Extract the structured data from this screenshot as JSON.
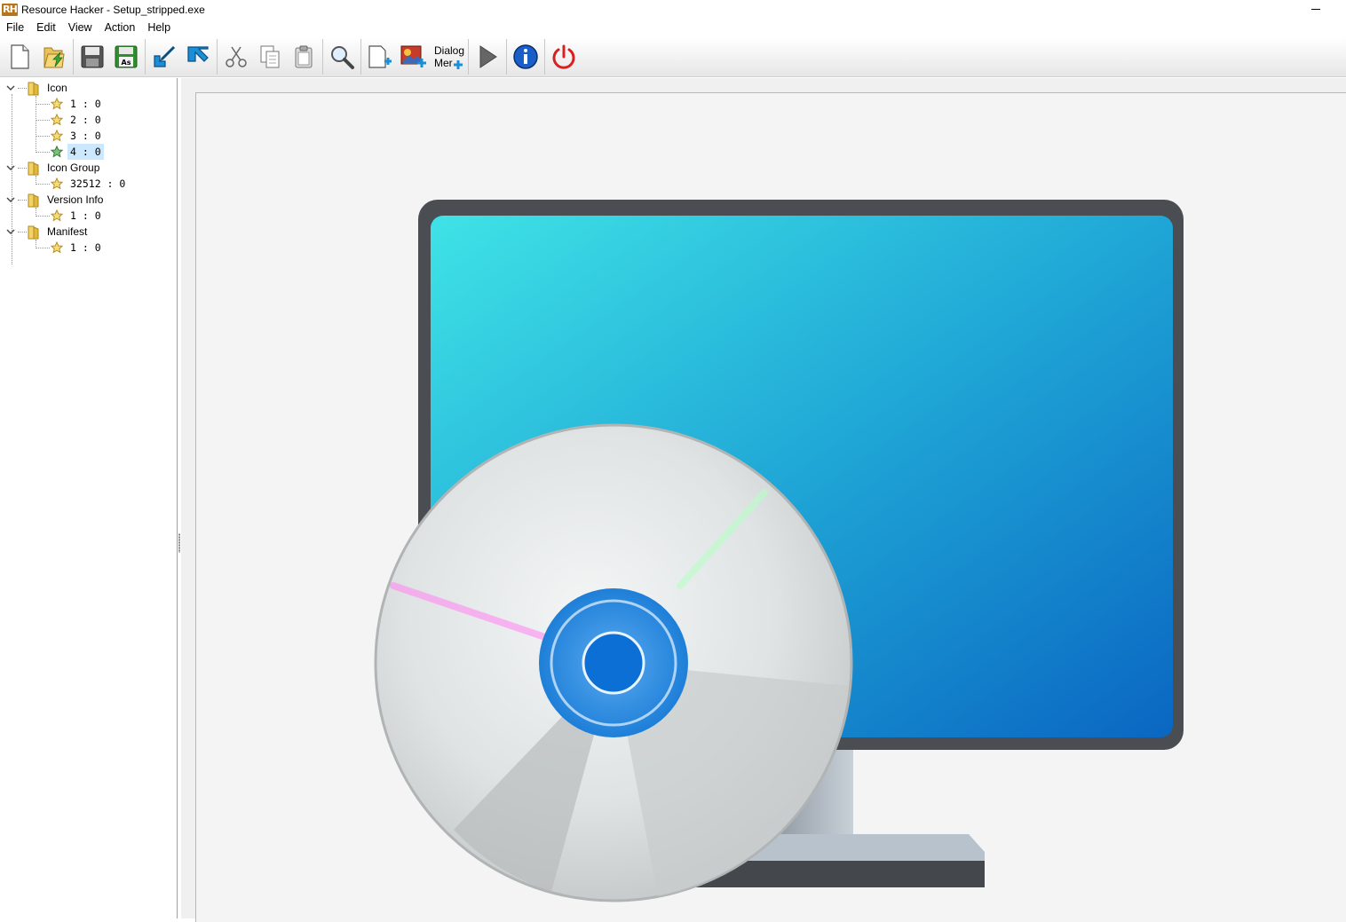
{
  "window": {
    "logo_text": "RH",
    "title": "Resource Hacker - Setup_stripped.exe"
  },
  "menu": [
    "File",
    "Edit",
    "View",
    "Action",
    "Help"
  ],
  "toolbar": {
    "dialog_menu_line1": "Dialog",
    "dialog_menu_line2": "Mer"
  },
  "tree": {
    "groups": [
      {
        "label": "Icon",
        "items": [
          "1 : 0",
          "2 : 0",
          "3 : 0",
          "4 : 0"
        ]
      },
      {
        "label": "Icon Group",
        "items": [
          "32512 : 0"
        ]
      },
      {
        "label": "Version Info",
        "items": [
          "1 : 0"
        ]
      },
      {
        "label": "Manifest",
        "items": [
          "1 : 0"
        ]
      }
    ],
    "selected": "Icon / 4 : 0"
  },
  "preview": {
    "subject": "setup-icon",
    "colors": {
      "screen_light": "#3fe3e6",
      "screen_dark": "#0a66c2",
      "bezel": "#4a4d52",
      "disc_hub": "#1e7fd8"
    }
  }
}
